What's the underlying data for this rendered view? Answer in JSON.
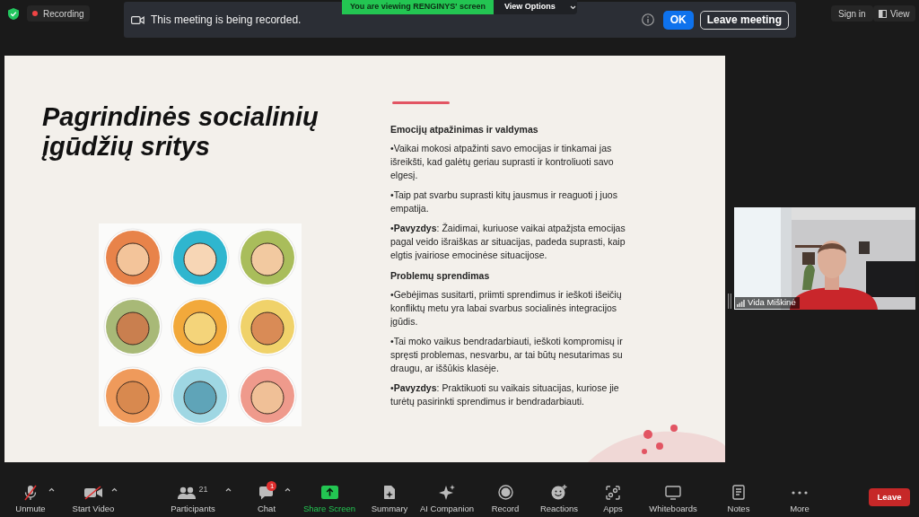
{
  "top_bar": {
    "recording": "Recording",
    "notice": "This meeting is being recorded.",
    "ok": "OK",
    "leave_meeting": "Leave meeting",
    "viewing_banner": "You are viewing RENGINYS' screen",
    "view_options": "View Options",
    "sign_in": "Sign in",
    "view": "View"
  },
  "slide": {
    "title": "Pagrindinės socialinių įgūdžių sritys",
    "sections": [
      {
        "heading": "Emocijų atpažinimas ir valdymas",
        "paragraphs": [
          "•Vaikai mokosi atpažinti savo emocijas ir tinkamai jas išreikšti, kad galėtų geriau suprasti ir kontroliuoti savo elgesį.",
          "•Taip pat svarbu suprasti kitų jausmus ir reaguoti į juos empatija.",
          "•**Pavyzdys**: Žaidimai, kuriuose vaikai atpažįsta emocijas pagal veido išraiškas ar situacijas, padeda suprasti, kaip elgtis įvairiose emocinėse situacijose."
        ]
      },
      {
        "heading": "Problemų sprendimas",
        "paragraphs": [
          "•Gebėjimas susitarti, priimti sprendimus ir ieškoti išeičių konfliktų metu yra labai svarbus socialinės integracijos įgūdis.",
          "•Tai moko vaikus bendradarbiauti, ieškoti kompromisų ir spręsti problemas, nesvarbu, ar tai būtų nesutarimas su draugu, ar iššūkis klasėje.",
          "•**Pavyzdys**: Praktikuoti su vaikais situacijas, kuriose jie turėtų pasirinkti sprendimus ir bendradarbiauti."
        ]
      }
    ]
  },
  "video_tile": {
    "name": "Vida Miškinė"
  },
  "toolbar": {
    "items": [
      {
        "kind": "micoff",
        "label": "Unmute",
        "menu": true
      },
      {
        "kind": "videooff",
        "label": "Start Video",
        "menu": true
      },
      {
        "kind": "participants",
        "label": "Participants",
        "count": "21",
        "menu": true
      },
      {
        "kind": "chat",
        "label": "Chat",
        "badge": "1",
        "menu": true
      },
      {
        "kind": "share",
        "label": "Share Screen",
        "menu": false
      },
      {
        "kind": "summary",
        "label": "Summary",
        "menu": false
      },
      {
        "kind": "ai",
        "label": "AI Companion",
        "menu": false
      },
      {
        "kind": "record",
        "label": "Record",
        "menu": false
      },
      {
        "kind": "reactions",
        "label": "Reactions",
        "menu": false
      },
      {
        "kind": "apps",
        "label": "Apps",
        "menu": false
      },
      {
        "kind": "whiteboards",
        "label": "Whiteboards",
        "menu": false
      },
      {
        "kind": "notes",
        "label": "Notes",
        "menu": false
      },
      {
        "kind": "more",
        "label": "More",
        "menu": false
      }
    ],
    "leave": "Leave"
  }
}
